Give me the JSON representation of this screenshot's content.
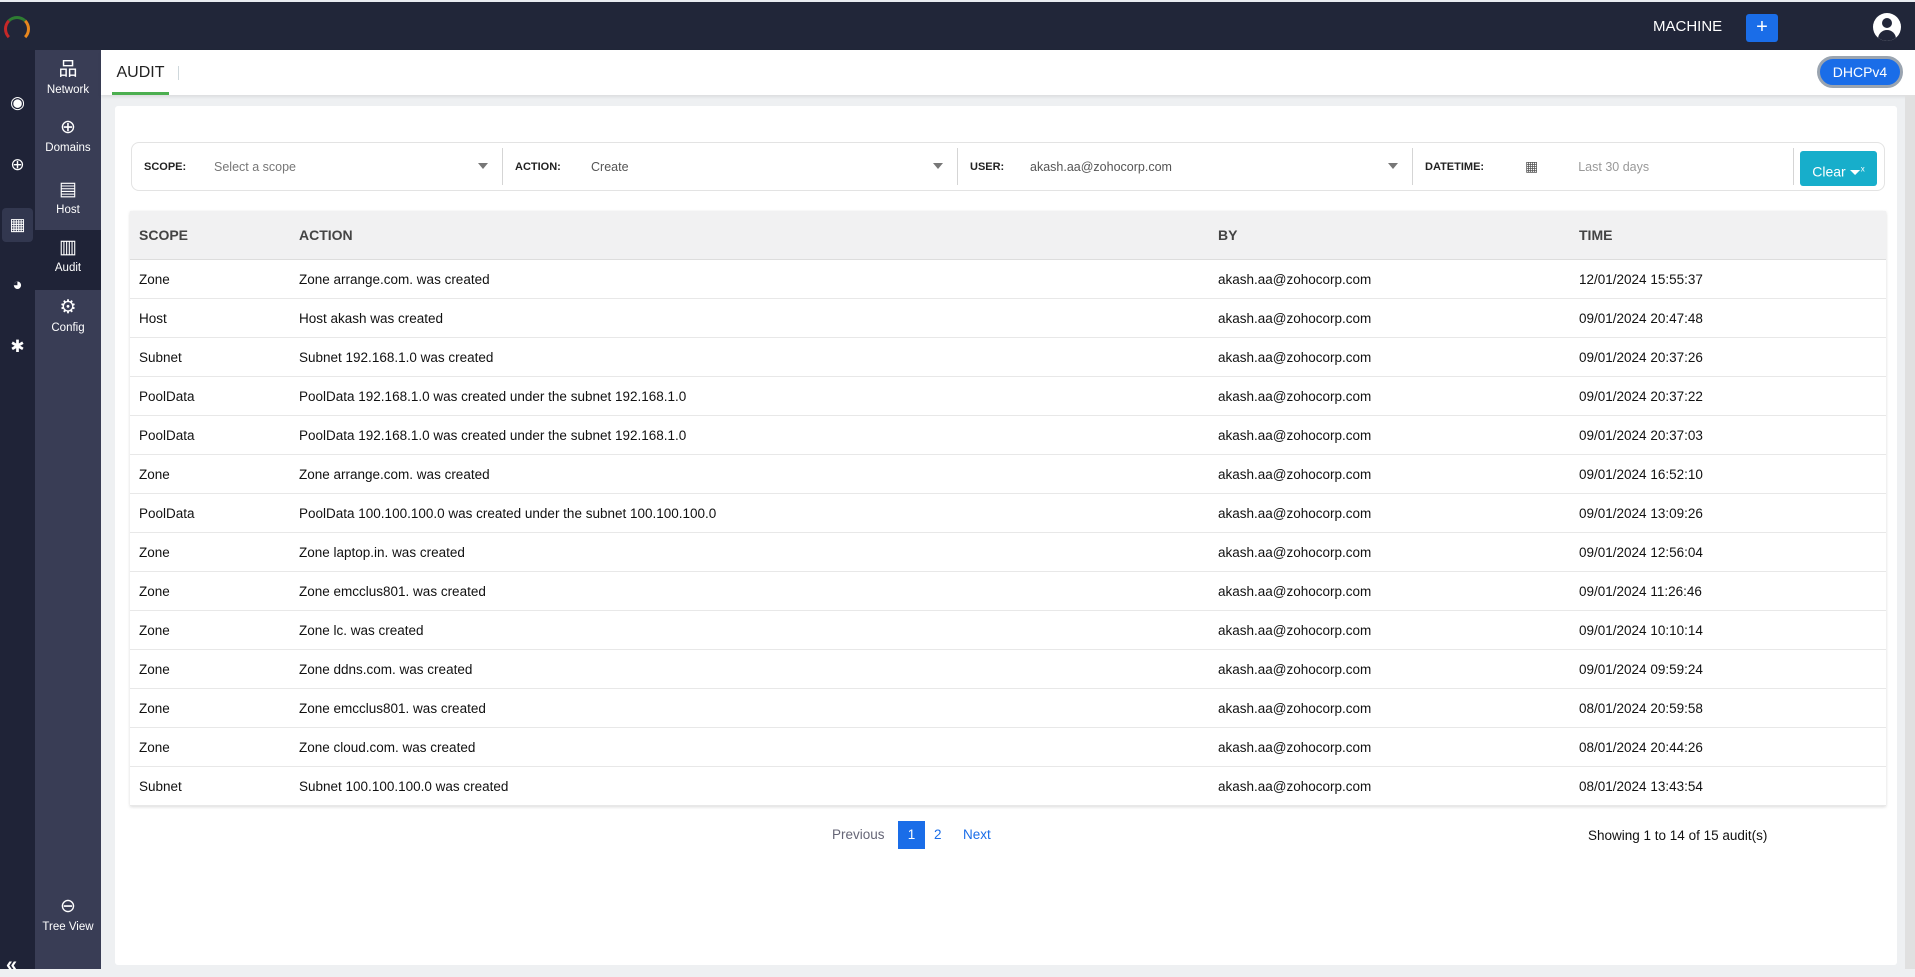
{
  "header": {
    "machine_label": "MACHINE",
    "add_label": "+"
  },
  "rail": {
    "icons": [
      "dashboard-icon",
      "dns-globe-icon",
      "ipam-icon",
      "reports-icon",
      "settings-icon"
    ],
    "collapse_label": "«"
  },
  "sidebar": {
    "items": [
      {
        "label": "Network",
        "icon": "network-icon"
      },
      {
        "label": "Domains",
        "icon": "domains-globe-icon"
      },
      {
        "label": "Host",
        "icon": "host-icon"
      },
      {
        "label": "Audit",
        "icon": "audit-icon",
        "active": true
      },
      {
        "label": "Config",
        "icon": "config-gears-icon"
      }
    ],
    "tree_view": "Tree View"
  },
  "tabs": {
    "active": "AUDIT",
    "service": "DHCPv4",
    "accent": "#4caf50"
  },
  "filters": {
    "scope_label": "SCOPE:",
    "scope_placeholder": "Select a scope",
    "action_label": "ACTION:",
    "action_value": "Create",
    "user_label": "USER:",
    "user_value": "akash.aa@zohocorp.com",
    "datetime_label": "DATETIME:",
    "datetime_value": "Last 30 days",
    "clear_label": "Clear"
  },
  "table": {
    "headers": [
      "SCOPE",
      "ACTION",
      "BY",
      "TIME"
    ],
    "rows": [
      [
        "Zone",
        "Zone arrange.com. was created",
        "akash.aa@zohocorp.com",
        "12/01/2024 15:55:37"
      ],
      [
        "Host",
        "Host akash was created",
        "akash.aa@zohocorp.com",
        "09/01/2024 20:47:48"
      ],
      [
        "Subnet",
        "Subnet 192.168.1.0 was created",
        "akash.aa@zohocorp.com",
        "09/01/2024 20:37:26"
      ],
      [
        "PoolData",
        "PoolData 192.168.1.0 was created under the subnet 192.168.1.0",
        "akash.aa@zohocorp.com",
        "09/01/2024 20:37:22"
      ],
      [
        "PoolData",
        "PoolData 192.168.1.0 was created under the subnet 192.168.1.0",
        "akash.aa@zohocorp.com",
        "09/01/2024 20:37:03"
      ],
      [
        "Zone",
        "Zone arrange.com. was created",
        "akash.aa@zohocorp.com",
        "09/01/2024 16:52:10"
      ],
      [
        "PoolData",
        "PoolData 100.100.100.0 was created under the subnet 100.100.100.0",
        "akash.aa@zohocorp.com",
        "09/01/2024 13:09:26"
      ],
      [
        "Zone",
        "Zone laptop.in. was created",
        "akash.aa@zohocorp.com",
        "09/01/2024 12:56:04"
      ],
      [
        "Zone",
        "Zone emcclus801. was created",
        "akash.aa@zohocorp.com",
        "09/01/2024 11:26:46"
      ],
      [
        "Zone",
        "Zone lc. was created",
        "akash.aa@zohocorp.com",
        "09/01/2024 10:10:14"
      ],
      [
        "Zone",
        "Zone ddns.com. was created",
        "akash.aa@zohocorp.com",
        "09/01/2024 09:59:24"
      ],
      [
        "Zone",
        "Zone emcclus801. was created",
        "akash.aa@zohocorp.com",
        "08/01/2024 20:59:58"
      ],
      [
        "Zone",
        "Zone cloud.com. was created",
        "akash.aa@zohocorp.com",
        "08/01/2024 20:44:26"
      ],
      [
        "Subnet",
        "Subnet 100.100.100.0 was created",
        "akash.aa@zohocorp.com",
        "08/01/2024 13:43:54"
      ]
    ]
  },
  "pagination": {
    "previous": "Previous",
    "pages": [
      "1",
      "2"
    ],
    "current": "1",
    "next": "Next",
    "summary": "Showing 1 to 14 of 15 audit(s)"
  }
}
